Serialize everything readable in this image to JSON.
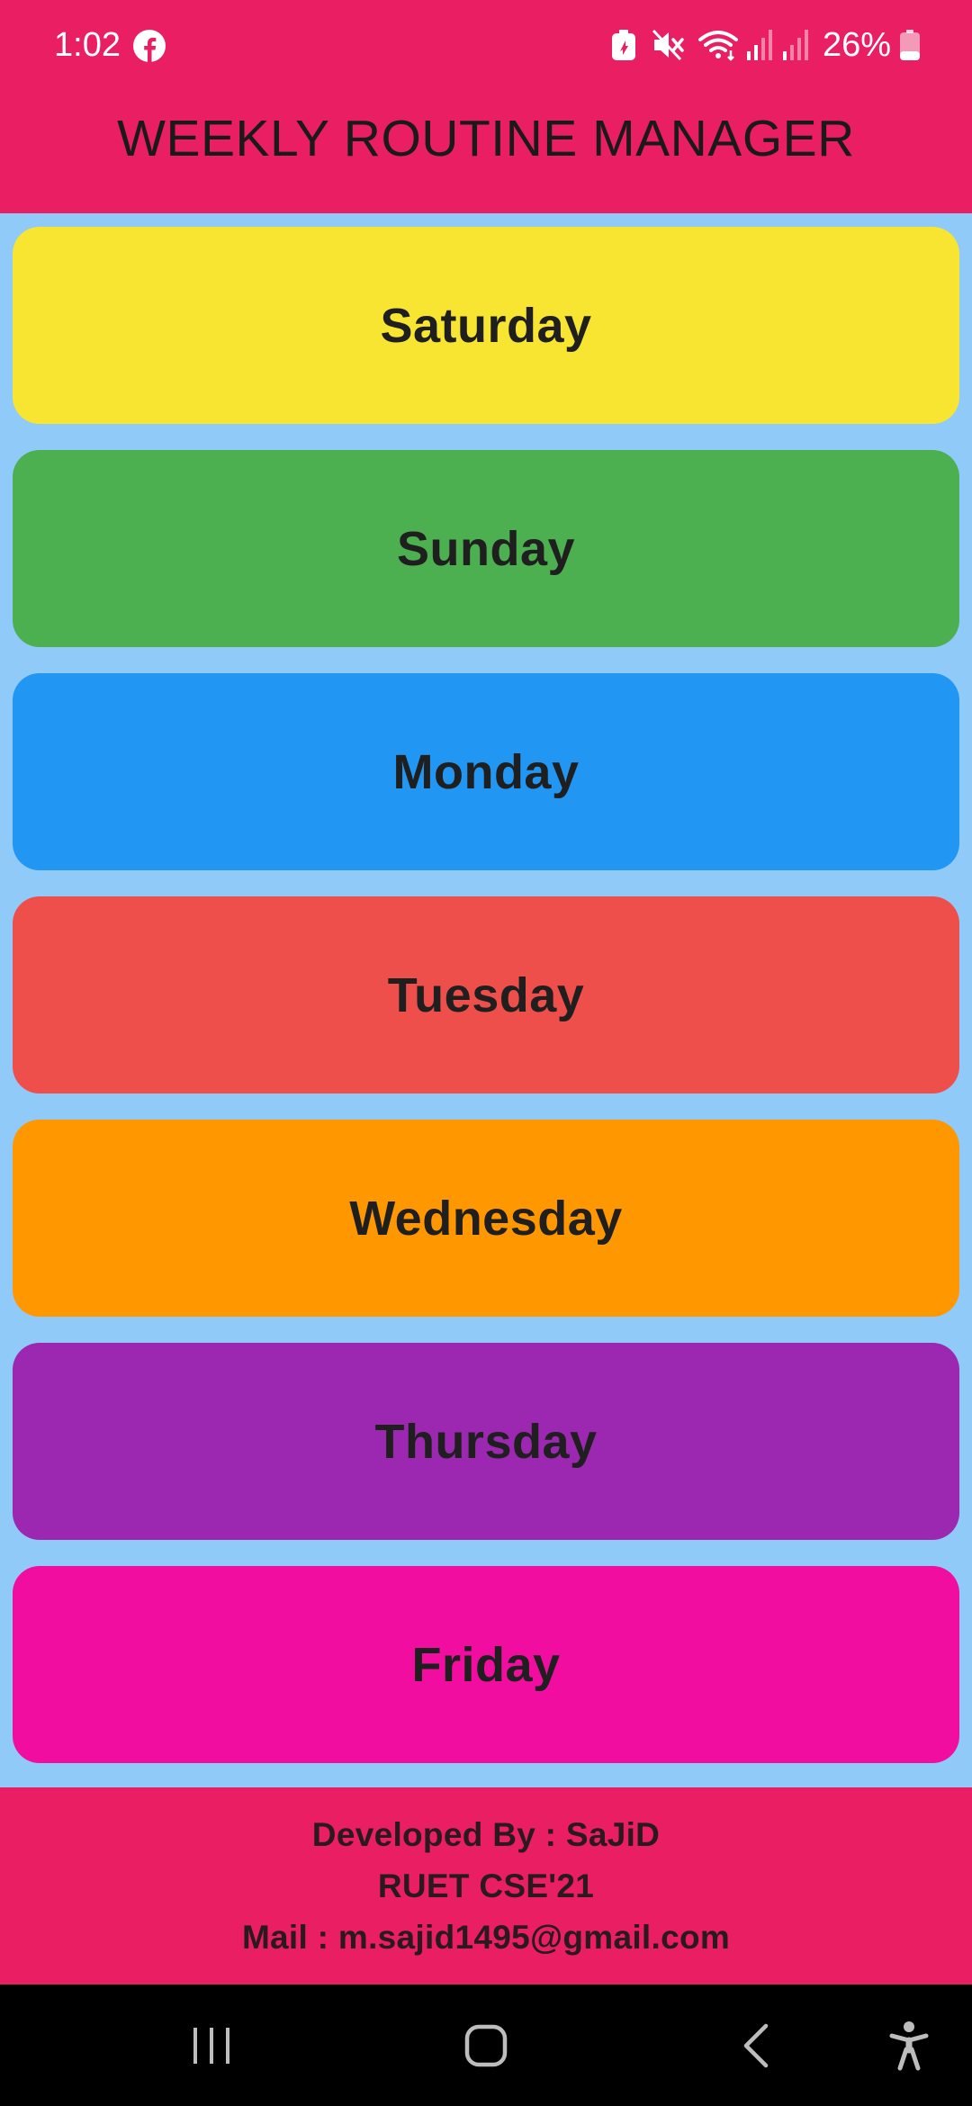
{
  "status_bar": {
    "time": "1:02",
    "battery_percent": "26%",
    "icons": [
      "facebook-icon",
      "battery-saver-icon",
      "mute-icon",
      "wifi-icon",
      "signal-icon",
      "signal-icon",
      "battery-icon"
    ]
  },
  "header": {
    "title": "WEEKLY ROUTINE MANAGER",
    "color": "#E91E63"
  },
  "background_color": "#90CAF9",
  "days": [
    {
      "label": "Saturday",
      "color": "#F7E531"
    },
    {
      "label": "Sunday",
      "color": "#4CAF50"
    },
    {
      "label": "Monday",
      "color": "#2196F3"
    },
    {
      "label": "Tuesday",
      "color": "#EF4F4A"
    },
    {
      "label": "Wednesday",
      "color": "#FF9800"
    },
    {
      "label": "Thursday",
      "color": "#9C27B0"
    },
    {
      "label": "Friday",
      "color": "#F10D9F"
    }
  ],
  "footer": {
    "developer": "Developed By : SaJiD",
    "institution": "RUET CSE'21",
    "mail": "Mail : m.sajid1495@gmail.com"
  },
  "nav_bar": {
    "buttons": [
      "recent-apps-icon",
      "home-icon",
      "back-icon",
      "accessibility-icon"
    ]
  }
}
